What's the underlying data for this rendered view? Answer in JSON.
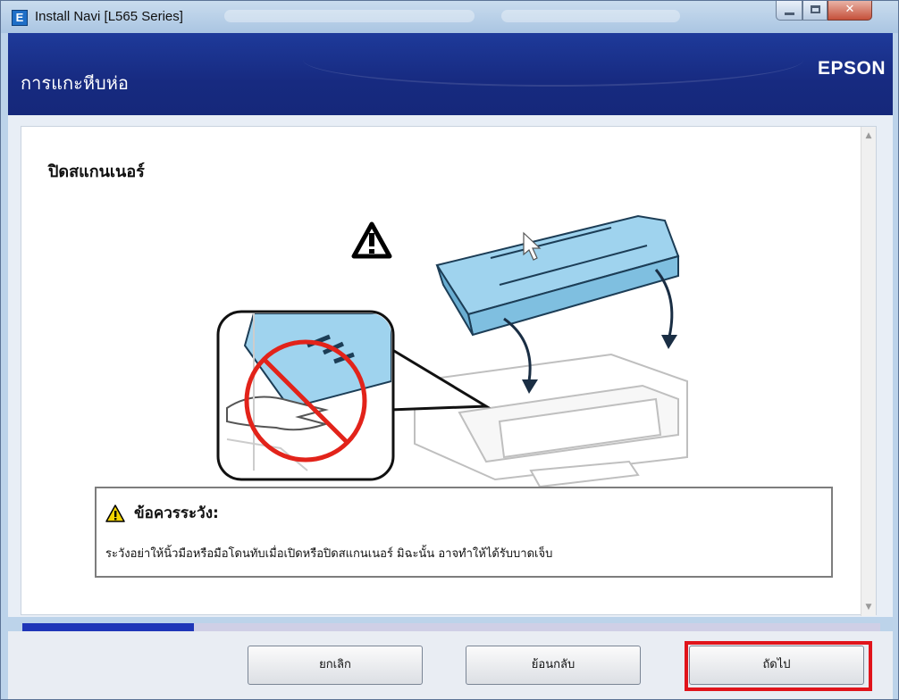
{
  "window": {
    "title": "Install Navi [L565 Series]",
    "app_icon_letter": "E"
  },
  "header": {
    "title": "การแกะหีบห่อ",
    "brand": "EPSON"
  },
  "main": {
    "section_title": "ปิดสแกนเนอร์",
    "caution": {
      "title": "ข้อควรระวัง:",
      "body": "ระวังอย่าให้นิ้วมือหรือมือโดนทับเมื่อเปิดหรือปิดสแกนเนอร์ มิฉะนั้น อาจทำให้ได้รับบาดเจ็บ"
    }
  },
  "progress": {
    "fraction": 0.2
  },
  "buttons": {
    "cancel": "ยกเลิก",
    "back": "ย้อนกลับ",
    "next": "ถัดไป"
  },
  "colors": {
    "header_blue": "#172a80",
    "progress_fill": "#1f36b8",
    "highlight_red": "#e0141b",
    "printer_blue": "#9fd3ee"
  }
}
